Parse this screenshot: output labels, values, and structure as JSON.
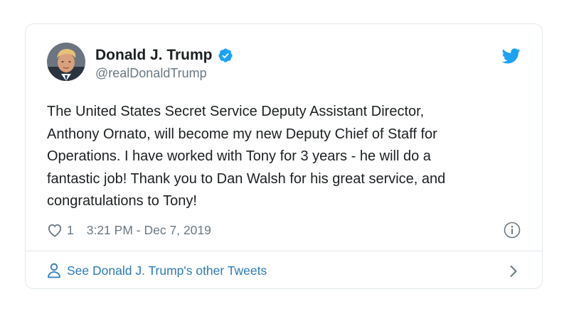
{
  "author": {
    "display_name": "Donald J. Trump",
    "handle": "@realDonaldTrump",
    "verified": true
  },
  "tweet": {
    "text": "The United States Secret Service Deputy Assistant Director,\nAnthony Ornato, will become my new Deputy Chief of Staff for\nOperations. I have worked with Tony for 3 years - he will do a\nfantastic job! Thank you to Dan Walsh for his great service, and\ncongratulations to Tony!",
    "like_count": "1",
    "timestamp": "3:21 PM - Dec 7, 2019"
  },
  "footer": {
    "link_label": "See Donald J. Trump's other Tweets"
  },
  "icons": {
    "verified": "verified-badge-icon",
    "brand": "twitter-bird-icon",
    "like": "heart-icon",
    "info": "info-icon",
    "profile": "person-icon",
    "more": "chevron-right-icon"
  },
  "colors": {
    "brand_blue": "#1da1f2",
    "link_blue": "#2b7bb9",
    "muted_text": "#697882",
    "body_text": "#1c2022",
    "border": "#e1e8ed"
  }
}
